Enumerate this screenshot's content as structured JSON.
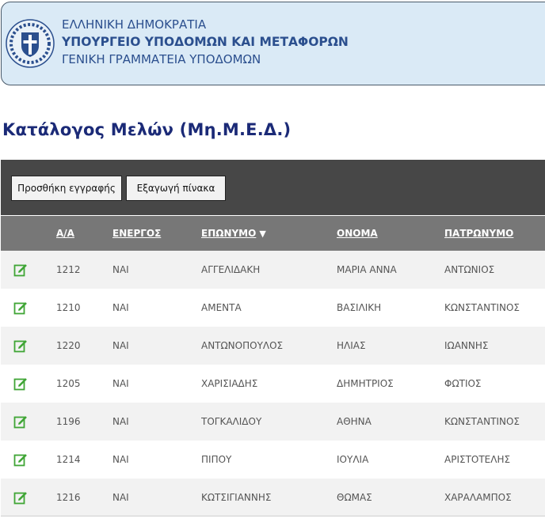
{
  "header": {
    "line1": "ΕΛΛΗΝΙΚΗ ΔΗΜΟΚΡΑΤΙΑ",
    "line2": "ΥΠΟΥΡΓΕΙΟ ΥΠΟΔΟΜΩΝ ΚΑΙ ΜΕΤΑΦΟΡΩΝ",
    "line3": "ΓΕΝΙΚΗ ΓΡΑΜΜΑΤΕΙΑ ΥΠΟΔΟΜΩΝ",
    "emblem_icon": "greek-coat-of-arms-icon"
  },
  "page": {
    "title": "Κατάλογος Μελών (Μη.Μ.Ε.Δ.)"
  },
  "toolbar": {
    "add_label": "Προσθήκη εγγραφής",
    "export_label": "Εξαγωγή πίνακα"
  },
  "table": {
    "columns": {
      "aa": "Α/Α",
      "active": "ΕΝΕΡΓΟΣ",
      "surname": "ΕΠΩΝΥΜΟ",
      "name": "ΟΝΟΜΑ",
      "father": "ΠΑΤΡΩΝΥΜΟ"
    },
    "sort": {
      "column": "surname",
      "direction": "descending",
      "icon": "sort-down-triangle-icon"
    },
    "rows": [
      {
        "aa": "1212",
        "active": "ΝΑΙ",
        "surname": "ΑΓΓΕΛΙΔΑΚΗ",
        "name": "ΜΑΡΙΑ ΑΝΝΑ",
        "father": "ΑΝΤΩΝΙΟΣ"
      },
      {
        "aa": "1210",
        "active": "ΝΑΙ",
        "surname": "ΑΜΕΝΤΑ",
        "name": "ΒΑΣΙΛΙΚΗ",
        "father": "ΚΩΝΣΤΑΝΤΙΝΟΣ"
      },
      {
        "aa": "1220",
        "active": "ΝΑΙ",
        "surname": "ΑΝΤΩΝΟΠΟΥΛΟΣ",
        "name": "ΗΛΙΑΣ",
        "father": "ΙΩΑΝΝΗΣ"
      },
      {
        "aa": "1205",
        "active": "ΝΑΙ",
        "surname": "ΧΑΡΙΣΙΑΔΗΣ",
        "name": "ΔΗΜΗΤΡΙΟΣ",
        "father": "ΦΩΤΙΟΣ"
      },
      {
        "aa": "1196",
        "active": "ΝΑΙ",
        "surname": "ΤΟΓΚΑΛΙΔΟΥ",
        "name": "ΑΘΗΝΑ",
        "father": "ΚΩΝΣΤΑΝΤΙΝΟΣ"
      },
      {
        "aa": "1214",
        "active": "ΝΑΙ",
        "surname": "ΠΙΠΟΥ",
        "name": "ΙΟΥΛΙΑ",
        "father": "ΑΡΙΣΤΟΤΕΛΗΣ"
      },
      {
        "aa": "1216",
        "active": "ΝΑΙ",
        "surname": "ΚΩΤΣΙΓΙΑΝΝΗΣ",
        "name": "ΘΩΜΑΣ",
        "father": "ΧΑΡΑΛΑΜΠΟΣ"
      }
    ],
    "row_icon": "edit-icon"
  },
  "colors": {
    "header_bg": "#daeaf6",
    "header_text": "#2b4f8e",
    "title": "#1b2a77",
    "toolbar_bg": "#474747",
    "table_header_bg": "#777777",
    "row_alt": "#f2f2f2",
    "edit_icon": "#3fa535"
  }
}
